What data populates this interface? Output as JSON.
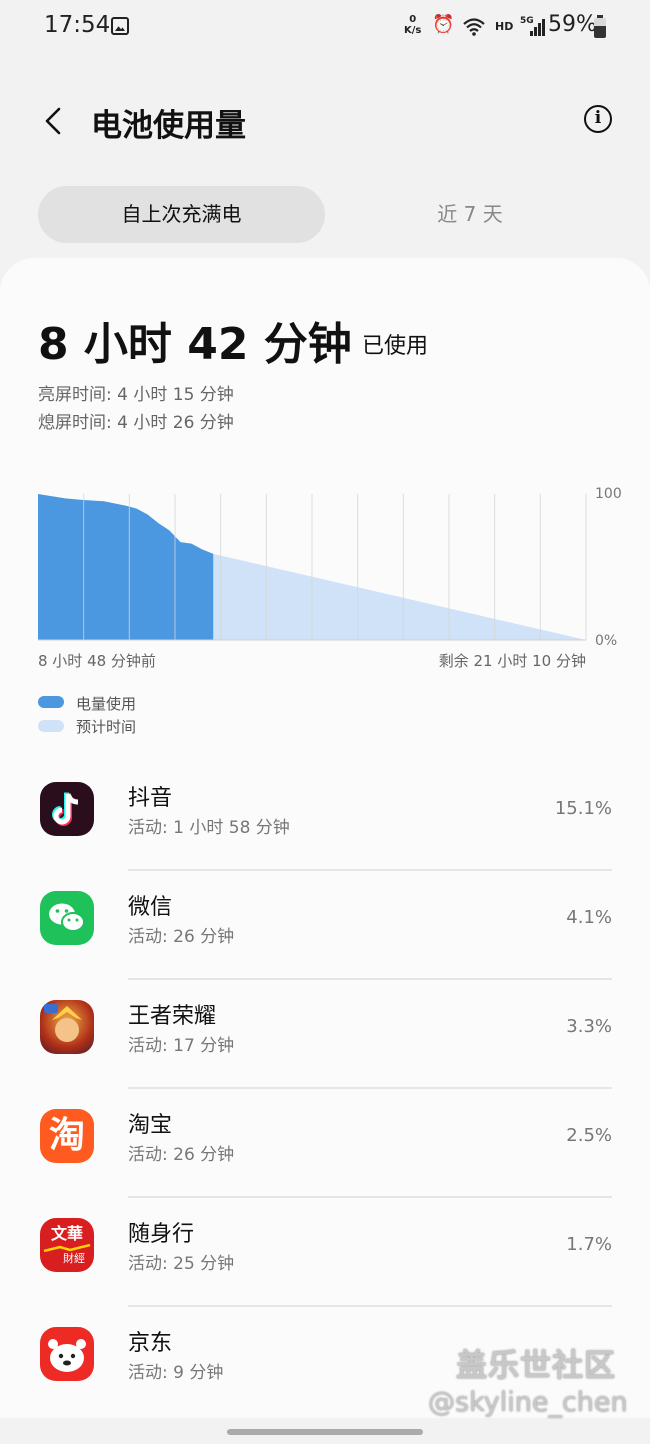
{
  "status_bar": {
    "time": "17:54",
    "net_speed_value": "0",
    "net_speed_unit": "K/s",
    "hd": "HD",
    "network": "5G",
    "battery": "59%"
  },
  "header": {
    "title": "电池使用量",
    "back_icon": "chevron-left-icon",
    "info_icon": "info-icon"
  },
  "tabs": [
    {
      "label": "自上次充满电",
      "selected": true
    },
    {
      "label": "近 7 天",
      "selected": false
    }
  ],
  "summary": {
    "used_time": "8 小时 42 分钟",
    "used_suffix": "已使用",
    "screen_on_label": "亮屏时间:",
    "screen_on_value": "4 小时 15 分钟",
    "screen_off_label": "熄屏时间:",
    "screen_off_value": "4 小时 26 分钟"
  },
  "chart_data": {
    "type": "area",
    "y_axis_labels": [
      "100",
      "0%"
    ],
    "ylim": [
      0,
      100
    ],
    "x_start_label": "8 小时 48 分钟前",
    "x_end_label": "剩余 21 小时 10 分钟",
    "series": [
      {
        "name": "电量使用",
        "color": "#4b97e0",
        "x": [
          0,
          0.05,
          0.08,
          0.12,
          0.16,
          0.18,
          0.2,
          0.22,
          0.24,
          0.26,
          0.28,
          0.3,
          0.32
        ],
        "y": [
          100,
          97,
          96,
          95,
          92,
          90,
          86,
          80,
          75,
          67,
          66,
          62,
          59
        ]
      },
      {
        "name": "预计时间",
        "color": "#cfe2f7",
        "x": [
          0.32,
          1.0
        ],
        "y": [
          59,
          0
        ]
      }
    ],
    "grid": true,
    "legend": [
      {
        "label": "电量使用",
        "color": "#4b97e0"
      },
      {
        "label": "预计时间",
        "color": "#cfe2f7"
      }
    ]
  },
  "apps": [
    {
      "name": "抖音",
      "activity": "活动: 1 小时 58 分钟",
      "percent": "15.1%",
      "icon": "douyin-icon"
    },
    {
      "name": "微信",
      "activity": "活动: 26 分钟",
      "percent": "4.1%",
      "icon": "wechat-icon"
    },
    {
      "name": "王者荣耀",
      "activity": "活动: 17 分钟",
      "percent": "3.3%",
      "icon": "honor-of-kings-icon"
    },
    {
      "name": "淘宝",
      "activity": "活动: 26 分钟",
      "percent": "2.5%",
      "icon": "taobao-icon",
      "icon_text": "淘"
    },
    {
      "name": "随身行",
      "activity": "活动: 25 分钟",
      "percent": "1.7%",
      "icon": "wenhua-icon",
      "icon_text_top": "文華",
      "icon_text_bottom": "財經"
    },
    {
      "name": "京东",
      "activity": "活动: 9 分钟",
      "percent": "",
      "icon": "jd-icon"
    }
  ],
  "watermark": {
    "line1": "盖乐世社区",
    "line2": "@skyline_chen"
  }
}
